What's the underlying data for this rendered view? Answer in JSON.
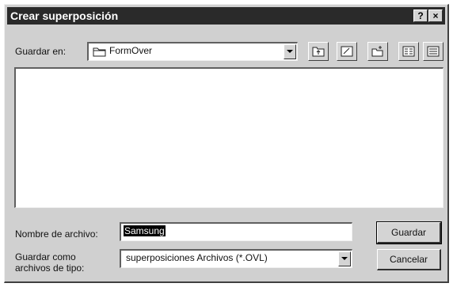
{
  "dialog": {
    "title": "Crear superposición",
    "help_label": "?",
    "close_label": "×"
  },
  "save_in": {
    "label": "Guardar en:",
    "folder": "FormOver"
  },
  "filename": {
    "label": "Nombre de archivo:",
    "value": "Samsung"
  },
  "filetype": {
    "label_line1": "Guardar como",
    "label_line2": "archivos de tipo:",
    "value": "superposiciones Archivos (*.OVL)"
  },
  "buttons": {
    "save": "Guardar",
    "cancel": "Cancelar"
  },
  "icons": {
    "folder": "folder-icon",
    "up": "up-one-level-icon",
    "desktop": "desktop-icon",
    "new_folder": "new-folder-icon",
    "list": "list-view-icon",
    "details": "details-view-icon"
  }
}
